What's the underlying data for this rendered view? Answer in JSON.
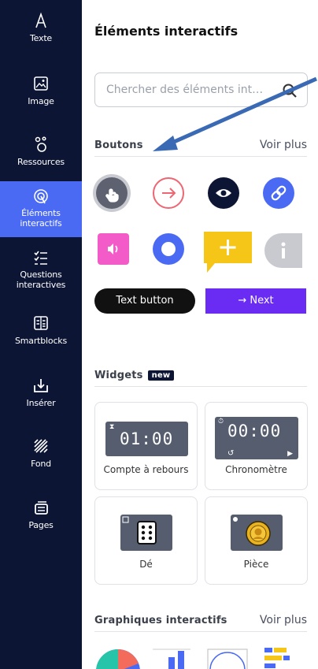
{
  "sidebar": {
    "items": [
      {
        "label": "Texte",
        "icon": "text-icon"
      },
      {
        "label": "Image",
        "icon": "image-icon"
      },
      {
        "label": "Ressources",
        "icon": "resources-icon"
      },
      {
        "label": "Éléments interactifs",
        "icon": "interactive-elements-icon",
        "active": true
      },
      {
        "label": "Questions interactives",
        "icon": "questions-icon"
      },
      {
        "label": "Smartblocks",
        "icon": "smartblocks-icon"
      },
      {
        "label": "Insérer",
        "icon": "insert-icon"
      },
      {
        "label": "Fond",
        "icon": "background-icon"
      },
      {
        "label": "Pages",
        "icon": "pages-icon"
      }
    ]
  },
  "panel": {
    "title": "Éléments interactifs",
    "search_placeholder": "Chercher des éléments int…"
  },
  "buttons_section": {
    "title": "Boutons",
    "more": "Voir plus",
    "text_button": "Text button",
    "next_button": "→ Next"
  },
  "widgets_section": {
    "title": "Widgets",
    "badge": "new",
    "cards": [
      {
        "label": "Compte à rebours",
        "display": "01:00"
      },
      {
        "label": "Chronomètre",
        "display": "00:00"
      },
      {
        "label": "Dé"
      },
      {
        "label": "Pièce"
      }
    ]
  },
  "charts_section": {
    "title": "Graphiques interactifs",
    "more": "Voir plus"
  },
  "colors": {
    "sidebar_bg": "#0d1534",
    "active_bg": "#4a6af4",
    "purple": "#6a2cf2",
    "annotation_arrow": "#4a78c8"
  }
}
